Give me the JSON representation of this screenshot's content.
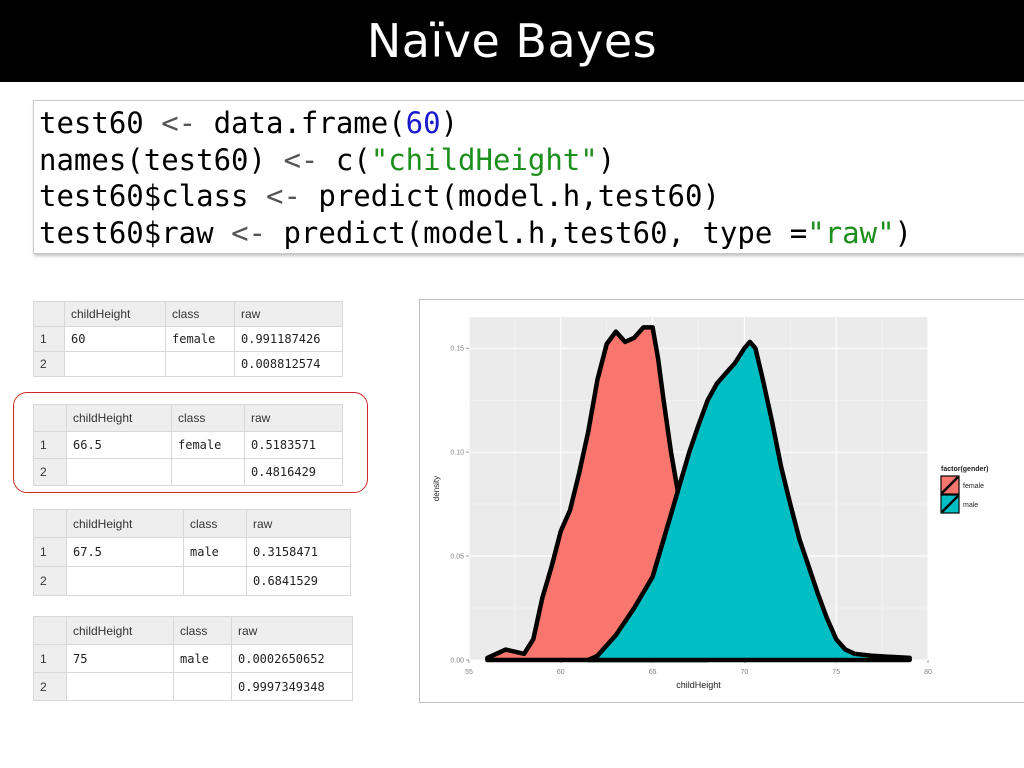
{
  "slide": {
    "title": "Naïve Bayes"
  },
  "code": {
    "lines": [
      [
        {
          "t": "test60 ",
          "c": ""
        },
        {
          "t": "<-",
          "c": "op"
        },
        {
          "t": " data.frame(",
          "c": ""
        },
        {
          "t": "60",
          "c": "num"
        },
        {
          "t": ")",
          "c": ""
        }
      ],
      [
        {
          "t": "names(test60) ",
          "c": ""
        },
        {
          "t": "<-",
          "c": "op"
        },
        {
          "t": " c(",
          "c": ""
        },
        {
          "t": "\"childHeight\"",
          "c": "str"
        },
        {
          "t": ")",
          "c": ""
        }
      ],
      [
        {
          "t": "test60$class ",
          "c": ""
        },
        {
          "t": "<-",
          "c": "op"
        },
        {
          "t": " predict(model.h,test60)",
          "c": ""
        }
      ],
      [
        {
          "t": "test60$raw ",
          "c": ""
        },
        {
          "t": "<-",
          "c": "op"
        },
        {
          "t": " predict(model.h,test60, type =",
          "c": ""
        },
        {
          "t": "\"raw\"",
          "c": "str"
        },
        {
          "t": ")",
          "c": ""
        }
      ]
    ]
  },
  "tables": [
    {
      "headers": [
        "",
        "childHeight",
        "class",
        "raw"
      ],
      "rows": [
        [
          "1",
          "60",
          "female",
          "0.991187426"
        ],
        [
          "2",
          "",
          "",
          "0.008812574"
        ]
      ]
    },
    {
      "headers": [
        "",
        "childHeight",
        "class",
        "raw"
      ],
      "rows": [
        [
          "1",
          "66.5",
          "female",
          "0.5183571"
        ],
        [
          "2",
          "",
          "",
          "0.4816429"
        ]
      ]
    },
    {
      "headers": [
        "",
        "childHeight",
        "class",
        "raw"
      ],
      "rows": [
        [
          "1",
          "67.5",
          "male",
          "0.3158471"
        ],
        [
          "2",
          "",
          "",
          "0.6841529"
        ]
      ]
    },
    {
      "headers": [
        "",
        "childHeight",
        "class",
        "raw"
      ],
      "rows": [
        [
          "1",
          "75",
          "male",
          "0.0002650652"
        ],
        [
          "2",
          "",
          "",
          "0.9997349348"
        ]
      ]
    }
  ],
  "colors": {
    "female": "#f8766d",
    "male": "#00bfc4",
    "panel": "#ebebeb",
    "highlight": "#cc2a2a"
  },
  "chart_data": {
    "type": "area",
    "title": "",
    "xlabel": "childHeight",
    "ylabel": "density",
    "xlim": [
      55,
      80
    ],
    "ylim": [
      0,
      0.165
    ],
    "x_ticks": [
      "55",
      "60",
      "65",
      "70",
      "75",
      "80"
    ],
    "y_ticks": [
      "0.00",
      "0.05",
      "0.10",
      "0.15"
    ],
    "grid": true,
    "legend": {
      "title": "factor(gender)",
      "position": "right",
      "entries": [
        "female",
        "male"
      ]
    },
    "series": [
      {
        "name": "female",
        "x": [
          56,
          57,
          58,
          58.5,
          59,
          59.5,
          60,
          60.5,
          61,
          61.5,
          62,
          62.5,
          63,
          63.5,
          64,
          64.5,
          65,
          65.3,
          65.6,
          66,
          66.5,
          67,
          67.5,
          68
        ],
        "y": [
          0.001,
          0.005,
          0.003,
          0.01,
          0.03,
          0.045,
          0.062,
          0.072,
          0.09,
          0.11,
          0.135,
          0.152,
          0.158,
          0.153,
          0.155,
          0.16,
          0.16,
          0.145,
          0.125,
          0.1,
          0.075,
          0.05,
          0.022,
          0.003
        ]
      },
      {
        "name": "male",
        "x": [
          61.5,
          62,
          63,
          64,
          65,
          65.5,
          66,
          66.5,
          67,
          67.5,
          68,
          68.5,
          69,
          69.5,
          70,
          70.3,
          70.6,
          71,
          71.5,
          72,
          72.5,
          73,
          73.5,
          74,
          74.5,
          75,
          75.5,
          76,
          77,
          78,
          79
        ],
        "y": [
          0,
          0.002,
          0.012,
          0.025,
          0.04,
          0.055,
          0.07,
          0.085,
          0.1,
          0.113,
          0.125,
          0.133,
          0.138,
          0.143,
          0.15,
          0.153,
          0.15,
          0.135,
          0.115,
          0.093,
          0.075,
          0.058,
          0.045,
          0.032,
          0.02,
          0.01,
          0.005,
          0.003,
          0.002,
          0.0015,
          0.001
        ]
      }
    ]
  }
}
